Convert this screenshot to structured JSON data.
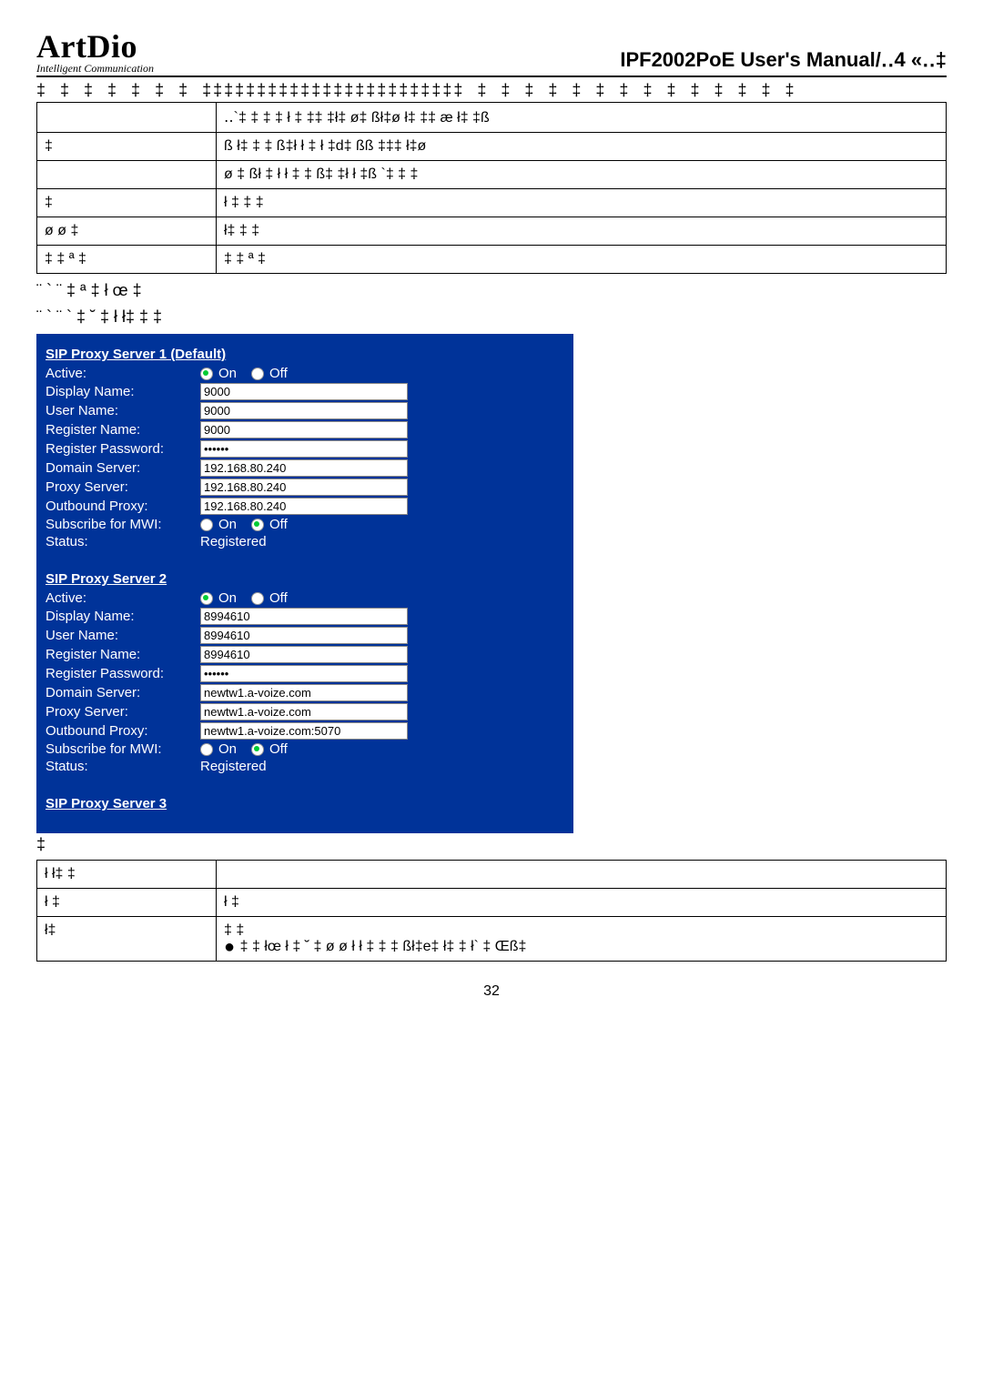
{
  "header": {
    "logo_main": "ArtDio",
    "logo_sub": "Intelligent Communication",
    "manual_title": "IPF2002PoE User's Manual/‥4 «‥‡"
  },
  "garbled_top": "‡  ‡  ‡  ‡  ‡  ‡  ‡  ‡‡‡‡‡‡‡‡‡‡‡‡‡‡‡‡‡‡‡‡‡‡‡‡  ‡  ‡  ‡  ‡  ‡  ‡  ‡  ‡  ‡  ‡  ‡  ‡  ‡  ‡",
  "table1": {
    "rows": [
      {
        "c1": "",
        "c2": "‥`‡   ‡   ‡   ‡  ł  ‡  ‡‡    ‡ł‡ ø‡ ßł‡ø  ł‡  ‡‡  æ    ł‡  ‡ß"
      },
      {
        "c1": "‡",
        "c2": "ß   ł‡     ‡           ‡    ß‡ł  ł   ‡  ł   ‡d‡ ßß  ‡‡‡   ł‡ø"
      },
      {
        "c1": "",
        "c2": "ø  ‡  ßł  ‡  ł   ł ‡        ‡   ß‡  ‡ł  ł    ‡ß   `‡  ‡  ‡"
      },
      {
        "c1": "‡",
        "c2": "ł ‡   ‡     ‡"
      },
      {
        "c1": "ø ø ‡",
        "c2": "ł‡   ‡     ‡"
      },
      {
        "c1": "‡     ‡  ª ‡",
        "c2": "‡    ‡  ª ‡"
      }
    ]
  },
  "notes": {
    "line1": "¨ ` ¨ ‡   ª ‡  ł    œ ‡",
    "line2": "¨ ` ¨ ` ‡ ˘ ‡  ł    ł‡     ‡  ‡"
  },
  "sip": {
    "on": "On",
    "off": "Off",
    "labels": {
      "active": "Active:",
      "display_name": "Display Name:",
      "user_name": "User Name:",
      "register_name": "Register Name:",
      "register_password": "Register Password:",
      "domain_server": "Domain Server:",
      "proxy_server": "Proxy Server:",
      "outbound_proxy": "Outbound Proxy:",
      "subscribe_mwi": "Subscribe for MWI:",
      "status": "Status:"
    },
    "server1": {
      "title": "SIP Proxy Server 1 (Default)",
      "active": "On",
      "display_name": "9000",
      "user_name": "9000",
      "register_name": "9000",
      "register_password": "••••••",
      "domain_server": "192.168.80.240",
      "proxy_server": "192.168.80.240",
      "outbound_proxy": "192.168.80.240",
      "subscribe_mwi": "Off",
      "status": "Registered"
    },
    "server2": {
      "title": "SIP Proxy Server 2",
      "active": "On",
      "display_name": "8994610",
      "user_name": "8994610",
      "register_name": "8994610",
      "register_password": "••••••",
      "domain_server": "newtw1.a-voize.com",
      "proxy_server": "newtw1.a-voize.com",
      "outbound_proxy": "newtw1.a-voize.com:5070",
      "subscribe_mwi": "Off",
      "status": "Registered"
    },
    "server3": {
      "title": "SIP Proxy Server 3"
    }
  },
  "after_panel": "‡",
  "table2": {
    "rows": [
      {
        "c1": "ł    ł‡     ‡",
        "c2": ""
      },
      {
        "c1": "ł  ‡",
        "c2": "ł      ‡"
      },
      {
        "c1": "ł‡",
        "c2": "‡      ‡\n‡    ‡  łœ   ł ‡ ˘ ‡   ø ø ł ł  ‡       ‡   ‡  ßł‡e‡ ł‡  ‡ ł` ‡ Œß‡",
        "bullet": true
      }
    ]
  },
  "page": "32"
}
